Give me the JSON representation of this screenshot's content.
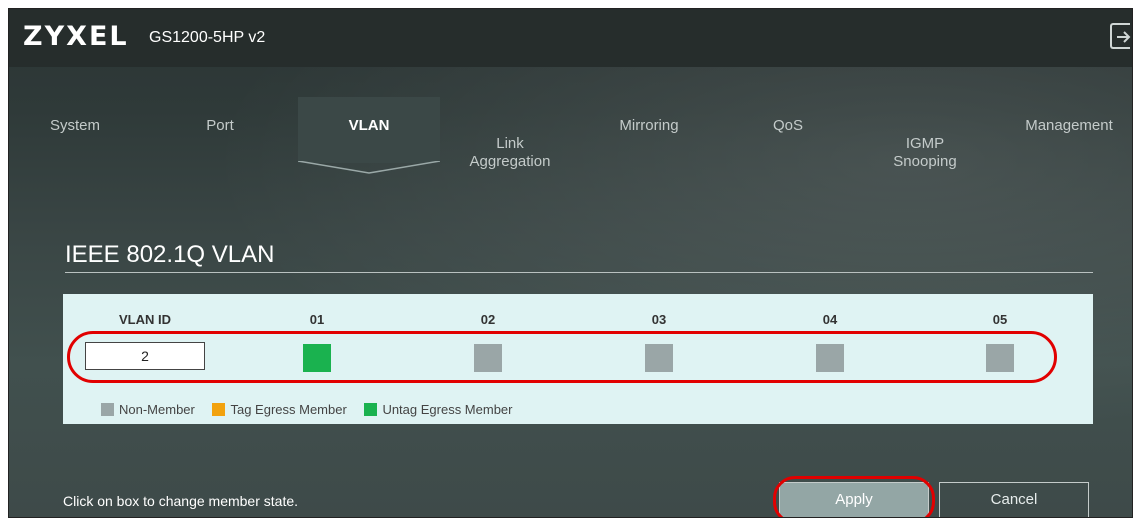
{
  "header": {
    "brand": "ZYXEL",
    "model": "GS1200-5HP v2",
    "logout_icon": "logout-icon"
  },
  "nav": {
    "tabs": [
      {
        "label": "System",
        "active": false
      },
      {
        "label": "Port",
        "active": false
      },
      {
        "label": "VLAN",
        "active": true
      },
      {
        "label": "Link\nAggregation",
        "active": false
      },
      {
        "label": "Mirroring",
        "active": false
      },
      {
        "label": "QoS",
        "active": false
      },
      {
        "label": "IGMP\nSnooping",
        "active": false
      },
      {
        "label": "Management",
        "active": false
      }
    ]
  },
  "page": {
    "title": "IEEE 802.1Q VLAN"
  },
  "vlan_table": {
    "vlan_id_header": "VLAN ID",
    "vlan_id_value": "2",
    "ports": [
      {
        "label": "01",
        "state": "untag"
      },
      {
        "label": "02",
        "state": "non-member"
      },
      {
        "label": "03",
        "state": "non-member"
      },
      {
        "label": "04",
        "state": "non-member"
      },
      {
        "label": "05",
        "state": "non-member"
      }
    ]
  },
  "legend": [
    {
      "label": "Non-Member",
      "color": "#9aa6a7"
    },
    {
      "label": "Tag Egress Member",
      "color": "#f2a20e"
    },
    {
      "label": "Untag Egress Member",
      "color": "#1ab24f"
    }
  ],
  "colors": {
    "non-member": "#9aa6a7",
    "tag": "#f2a20e",
    "untag": "#1ab24f",
    "highlight": "#e10000"
  },
  "footer": {
    "hint": "Click on box to change member state.",
    "apply_label": "Apply",
    "cancel_label": "Cancel"
  }
}
